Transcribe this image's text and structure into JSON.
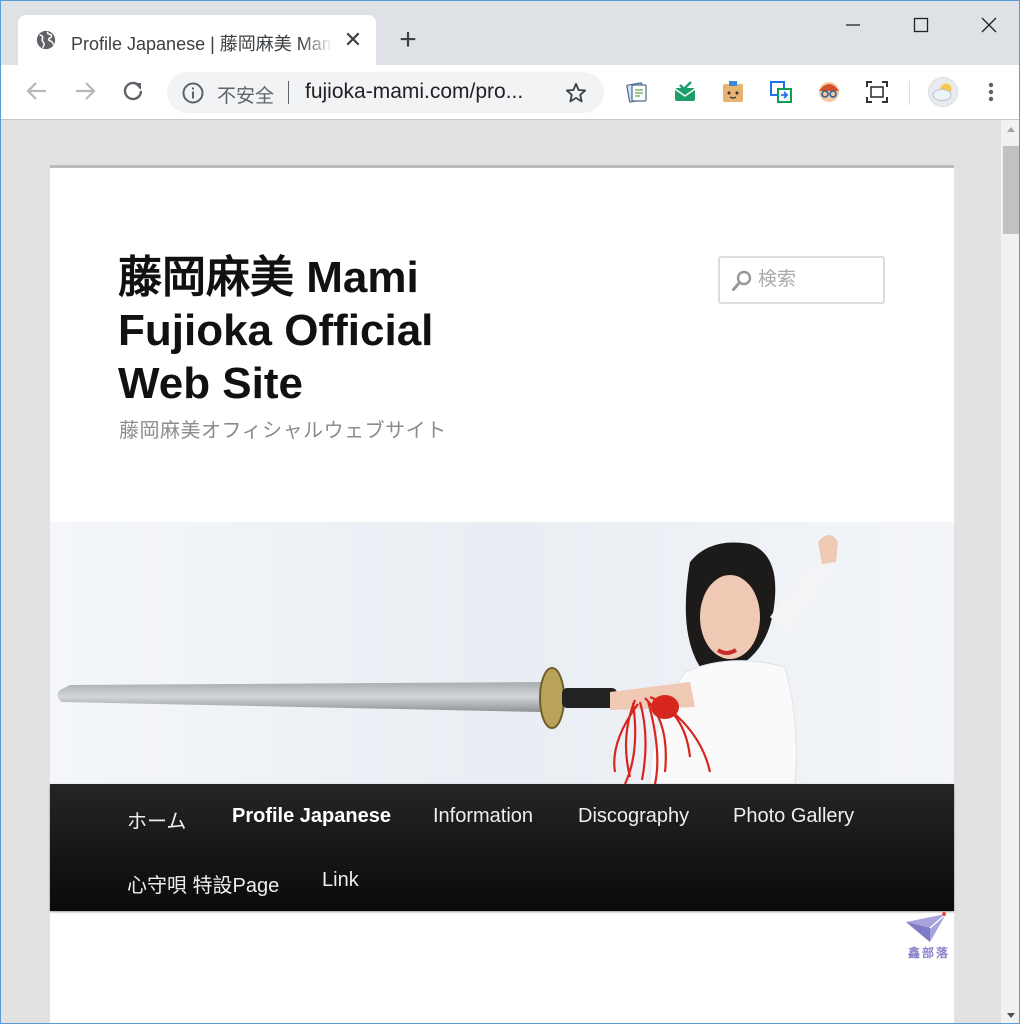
{
  "browser": {
    "tab_title": "Profile Japanese | 藤岡麻美 Mami Fujioka Official Web Site",
    "omnibox": {
      "security_label": "不安全",
      "url": "fujioka-mami.com/pro..."
    },
    "extensions": [
      "notes-icon",
      "mail-check-icon",
      "box-face-icon",
      "share-window-icon",
      "cartoon-avatar-icon",
      "screenshot-icon"
    ]
  },
  "site": {
    "title": "藤岡麻美 Mami Fujioka Official Web Site",
    "description": "藤岡麻美オフィシャルウェブサイト",
    "search_placeholder": "検索"
  },
  "nav": {
    "items": [
      {
        "label": "ホーム"
      },
      {
        "label": "Profile Japanese"
      },
      {
        "label": "Information"
      },
      {
        "label": "Discography"
      },
      {
        "label": "Photo Gallery"
      },
      {
        "label": "心守唄 特設Page"
      },
      {
        "label": "Link"
      }
    ]
  },
  "watermark": {
    "text": "鑫部落"
  },
  "colors": {
    "tab_strip": "#dee1e6",
    "navbar": "#1a1a1a",
    "accent_red": "#d7261e"
  }
}
